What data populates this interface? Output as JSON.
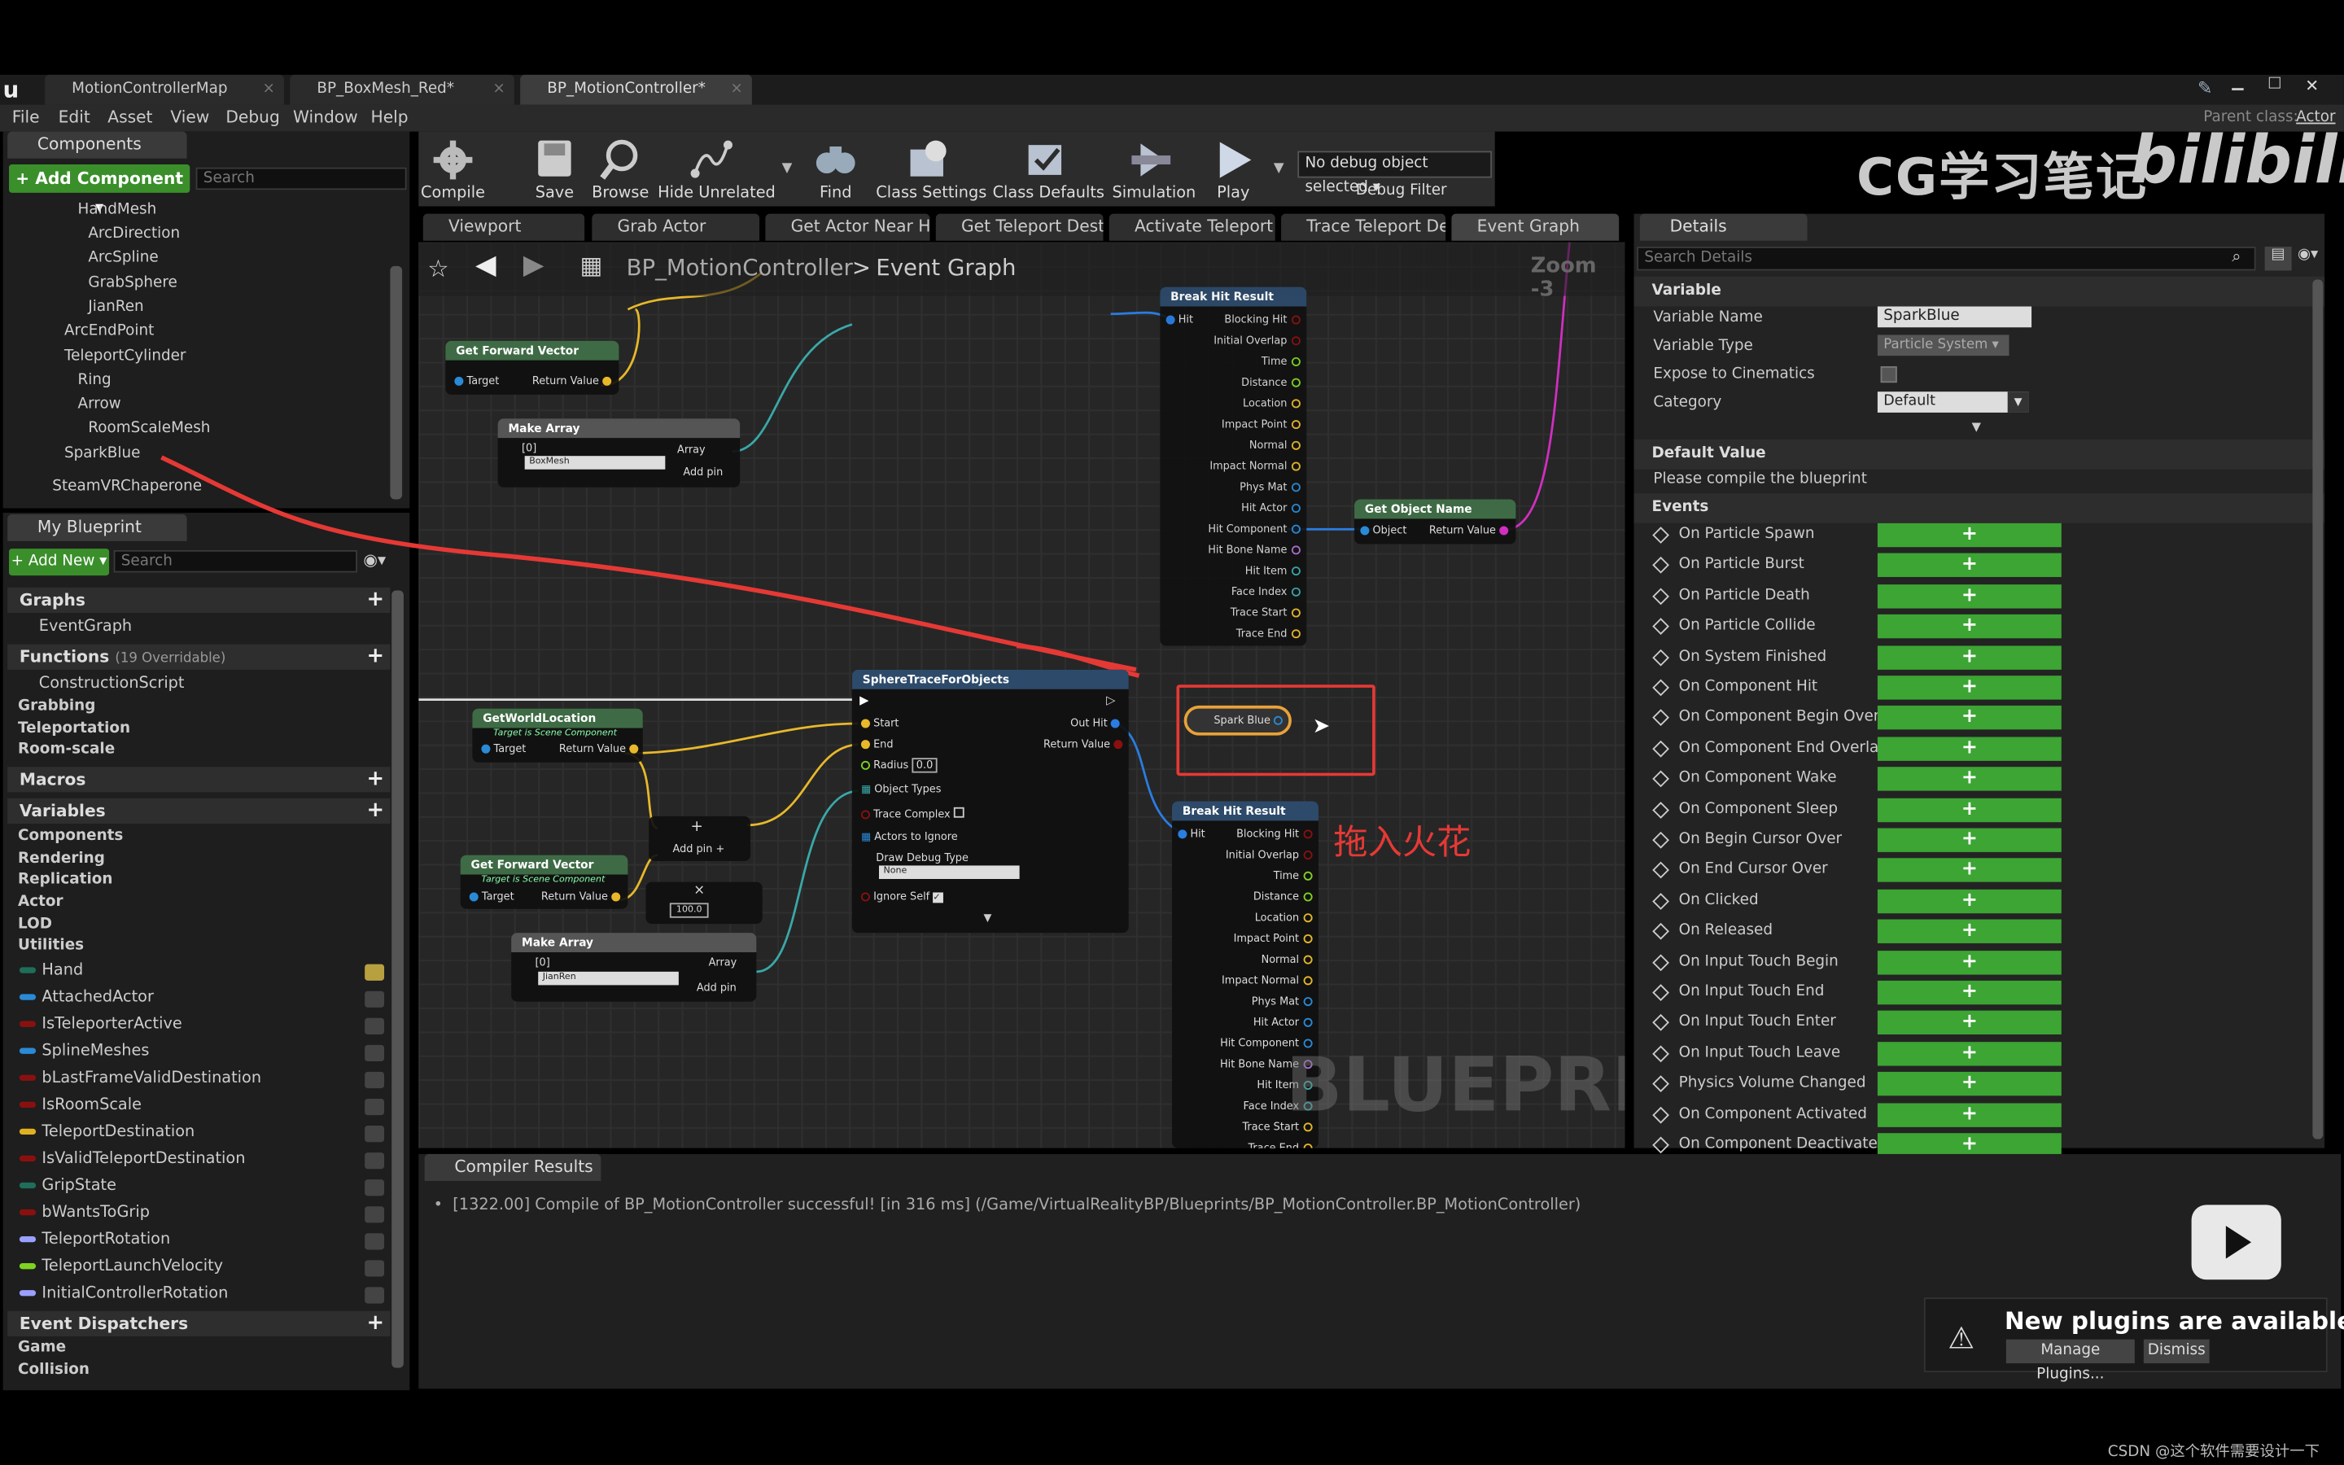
{
  "window": {
    "tabs": [
      {
        "label": "MotionControllerMap"
      },
      {
        "label": "BP_BoxMesh_Red*"
      },
      {
        "label": "BP_MotionController*"
      }
    ],
    "parent_class_label": "Parent class:",
    "parent_class_value": "Actor"
  },
  "menu": [
    "File",
    "Edit",
    "Asset",
    "View",
    "Debug",
    "Window",
    "Help"
  ],
  "components": {
    "tab": "Components",
    "add_button": "+ Add Component ▾",
    "search_placeholder": "Search",
    "tree": [
      "HandMesh",
      "ArcDirection",
      "ArcSpline",
      "GrabSphere",
      "JianRen",
      "ArcEndPoint",
      "TeleportCylinder",
      "Ring",
      "Arrow",
      "RoomScaleMesh",
      "SparkBlue",
      "SteamVRChaperone"
    ]
  },
  "my_blueprint": {
    "tab": "My Blueprint",
    "add_new": "+ Add New ▾",
    "search_placeholder": "Search",
    "graphs_header": "Graphs",
    "graphs": [
      "EventGraph"
    ],
    "functions_header": "Functions",
    "functions_count": "(19 Overridable)",
    "functions": [
      "ConstructionScript"
    ],
    "function_categories": [
      "Grabbing",
      "Teleportation",
      "Room-scale"
    ],
    "macros_header": "Macros",
    "variables_header": "Variables",
    "variable_categories": [
      "Components",
      "Rendering",
      "Replication",
      "Actor",
      "LOD",
      "Utilities"
    ],
    "variables": [
      {
        "name": "Hand",
        "color": "#1f6e5a"
      },
      {
        "name": "AttachedActor",
        "color": "#2a8ad6"
      },
      {
        "name": "IsTeleporterActive",
        "color": "#8a1010"
      },
      {
        "name": "SplineMeshes",
        "color": "#2a8ad6"
      },
      {
        "name": "bLastFrameValidDestination",
        "color": "#8a1010"
      },
      {
        "name": "IsRoomScale",
        "color": "#8a1010"
      },
      {
        "name": "TeleportDestination",
        "color": "#e0b020"
      },
      {
        "name": "IsValidTeleportDestination",
        "color": "#8a1010"
      },
      {
        "name": "GripState",
        "color": "#1f6e5a"
      },
      {
        "name": "bWantsToGrip",
        "color": "#8a1010"
      },
      {
        "name": "TeleportRotation",
        "color": "#9aa0ff"
      },
      {
        "name": "TeleportLaunchVelocity",
        "color": "#7ed321"
      },
      {
        "name": "InitialControllerRotation",
        "color": "#9aa0ff"
      }
    ],
    "event_dispatchers_header": "Event Dispatchers",
    "dispatcher_categories": [
      "Game",
      "Collision"
    ]
  },
  "toolbar": {
    "compile": "Compile",
    "save": "Save",
    "browse": "Browse",
    "hide_unrelated": "Hide Unrelated",
    "find": "Find",
    "class_settings": "Class Settings",
    "class_defaults": "Class Defaults",
    "simulation": "Simulation",
    "play": "Play",
    "debug_select": "No debug object selected ▾",
    "debug_filter": "Debug Filter"
  },
  "watermark": {
    "text": "CG学习笔记",
    "brand": "bilibili"
  },
  "graph_tabs": [
    "Viewport",
    "Grab Actor",
    "Get Actor Near H",
    "Get Teleport Dest",
    "Activate Teleport",
    "Trace Teleport De",
    "Event Graph"
  ],
  "graph": {
    "breadcrumb_class": "BP_MotionController",
    "breadcrumb_sep": ">",
    "breadcrumb_graph": "Event Graph",
    "zoom": "Zoom -3",
    "watermark": "BLUEPRINT",
    "annotation": "拖入火花",
    "nodes": {
      "get_world_location": "GetWorldLocation",
      "get_forward_vector": "Get Forward Vector",
      "target_is_scene": "Target is Scene Component",
      "target": "Target",
      "return_value": "Return Value",
      "make_array": "Make Array",
      "array": "Array",
      "add_pin": "Add pin",
      "index0": "[0]",
      "boxmesh": "BoxMesh",
      "jianren": "JianRen",
      "sphere_trace": "SphereTraceForObjects",
      "start": "Start",
      "end": "End",
      "radius": "Radius",
      "radius_val": "0.0",
      "out_hit": "Out Hit",
      "object_types": "Object Types",
      "trace_complex": "Trace Complex",
      "actors_to_ignore": "Actors to Ignore",
      "draw_debug_type": "Draw Debug Type",
      "none": "None",
      "ignore_self": "Ignore Self",
      "val100": "100.0",
      "break_hit": "Break Hit Result",
      "hit": "Hit",
      "get_object_name": "Get Object Name",
      "object": "Object",
      "spark_blue": "Spark Blue",
      "break_fields": [
        "Blocking Hit",
        "Initial Overlap",
        "Time",
        "Distance",
        "Location",
        "Impact Point",
        "Normal",
        "Impact Normal",
        "Phys Mat",
        "Hit Actor",
        "Hit Component",
        "Hit Bone Name",
        "Hit Item",
        "Face Index",
        "Trace Start",
        "Trace End"
      ]
    }
  },
  "details": {
    "tab": "Details",
    "search_placeholder": "Search Details",
    "variable_header": "Variable",
    "variable_name_label": "Variable Name",
    "variable_name_value": "SparkBlue",
    "variable_type_label": "Variable Type",
    "variable_type_value": "Particle System ▾",
    "expose_label": "Expose to Cinematics",
    "category_label": "Category",
    "category_value": "Default",
    "default_value_header": "Default Value",
    "compile_note": "Please compile the blueprint",
    "events_header": "Events",
    "events": [
      "On Particle Spawn",
      "On Particle Burst",
      "On Particle Death",
      "On Particle Collide",
      "On System Finished",
      "On Component Hit",
      "On Component Begin Overlap",
      "On Component End Overlap",
      "On Component Wake",
      "On Component Sleep",
      "On Begin Cursor Over",
      "On End Cursor Over",
      "On Clicked",
      "On Released",
      "On Input Touch Begin",
      "On Input Touch End",
      "On Input Touch Enter",
      "On Input Touch Leave",
      "Physics Volume Changed",
      "On Component Activated",
      "On Component Deactivated"
    ],
    "add_label": "+"
  },
  "compiler": {
    "tab": "Compiler Results",
    "message": "[1322.00] Compile of BP_MotionController successful! [in 316 ms] (/Game/VirtualRealityBP/Blueprints/BP_MotionController.BP_MotionController)"
  },
  "notification": {
    "title": "New plugins are available",
    "manage": "Manage Plugins...",
    "dismiss": "Dismiss"
  },
  "footer": "CSDN @这个软件需要设计一下"
}
